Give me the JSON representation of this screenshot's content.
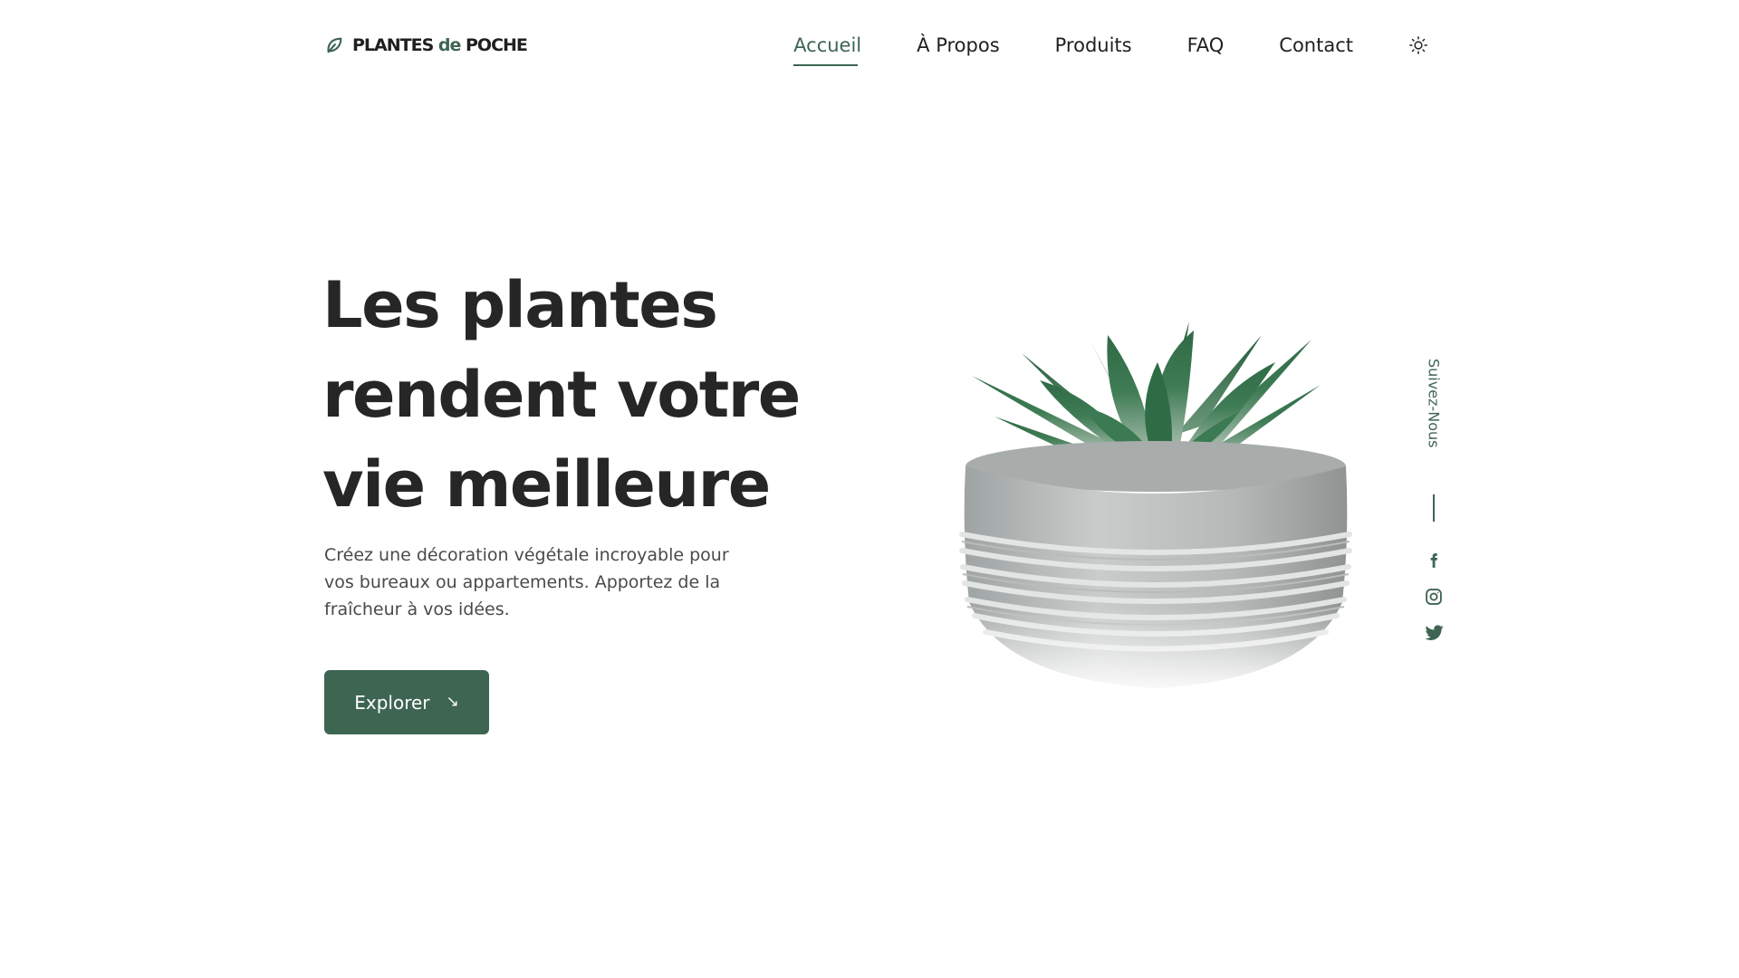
{
  "brand": {
    "name_part1": "PLANTES ",
    "name_accent": "de",
    "name_part2": " POCHE",
    "icon": "leaf-icon"
  },
  "nav": {
    "items": [
      {
        "label": "Accueil",
        "active": true
      },
      {
        "label": "À Propos",
        "active": false
      },
      {
        "label": "Produits",
        "active": false
      },
      {
        "label": "FAQ",
        "active": false
      },
      {
        "label": "Contact",
        "active": false
      }
    ],
    "theme_icon": "sun-icon"
  },
  "hero": {
    "title": "Les plantes rendent votre vie meilleure",
    "description": "Créez une décoration végétale incroyable pour vos bureaux ou appartements. Apportez de la fraîcheur à vos idées.",
    "button_label": "Explorer",
    "button_icon": "arrow-down-right-icon",
    "image": "succulent-in-concrete-pot"
  },
  "social": {
    "title": "Suivez-Nous",
    "icons": [
      "facebook-icon",
      "instagram-icon",
      "twitter-icon"
    ]
  },
  "colors": {
    "accent": "#3d6552",
    "text": "#262626",
    "muted": "#4a4a4a",
    "background": "#ffffff"
  }
}
